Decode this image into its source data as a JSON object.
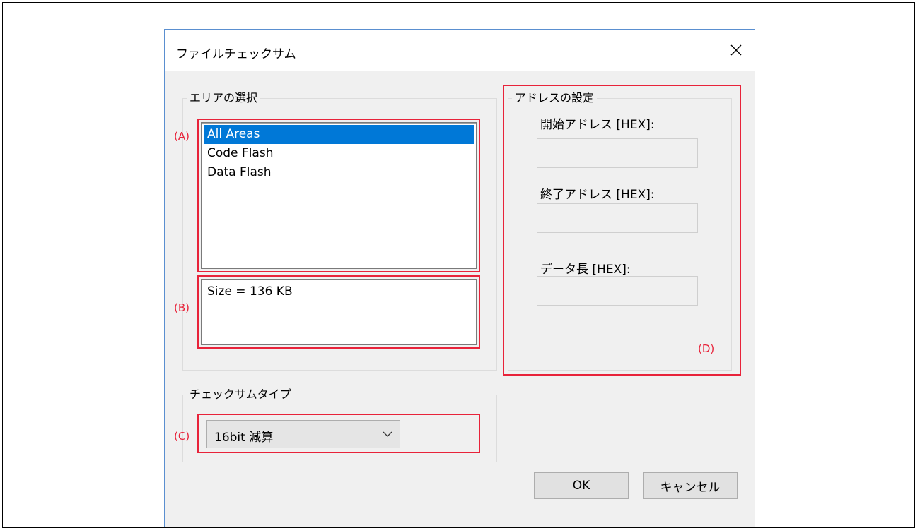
{
  "dialog": {
    "title": "ファイルチェックサム",
    "close_icon": "close-icon"
  },
  "area_group": {
    "legend": "エリアの選択",
    "list_items": [
      {
        "label": "All Areas",
        "selected": true
      },
      {
        "label": "Code Flash",
        "selected": false
      },
      {
        "label": "Data Flash",
        "selected": false
      }
    ],
    "size_text": "Size = 136 KB"
  },
  "address_group": {
    "legend": "アドレスの設定",
    "start_label": "開始アドレス [HEX]:",
    "start_value": "",
    "end_label": "終了アドレス [HEX]:",
    "end_value": "",
    "length_label": "データ長 [HEX]:",
    "length_value": ""
  },
  "checksum_group": {
    "legend": "チェックサムタイプ",
    "selected_value": "16bit 減算"
  },
  "annotations": {
    "a": "(A)",
    "b": "(B)",
    "c": "(C)",
    "d": "(D)",
    "color": "#e8233a"
  },
  "buttons": {
    "ok": "OK",
    "cancel": "キャンセル"
  },
  "colors": {
    "selection": "#0078d7",
    "dialog_border": "#5a8fd0",
    "dialog_bg": "#f0f0f0"
  }
}
